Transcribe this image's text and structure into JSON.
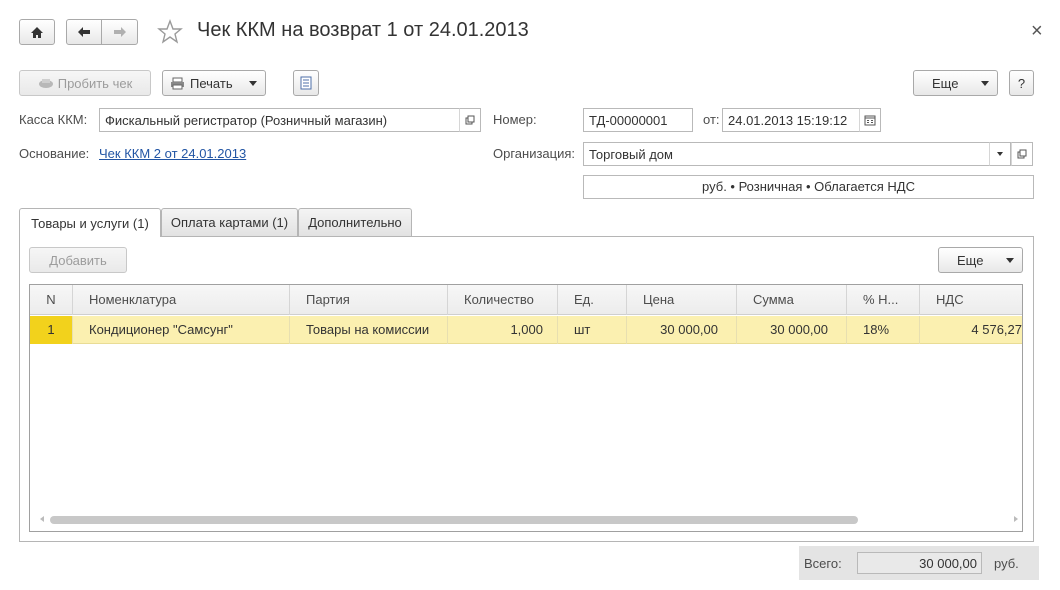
{
  "window": {
    "title": "Чек ККМ на возврат 1 от 24.01.2013",
    "close_glyph": "×"
  },
  "toolbar": {
    "punch_check": "Пробить чек",
    "print": "Печать",
    "more": "Еще",
    "help": "?"
  },
  "form": {
    "cash_register_label": "Касса ККМ:",
    "cash_register_value": "Фискальный регистратор (Розничный магазин)",
    "number_label": "Номер:",
    "number_value": "ТД-00000001",
    "date_label": "от:",
    "date_value": "24.01.2013 15:19:12",
    "basis_label": "Основание:",
    "basis_link": "Чек ККМ 2 от 24.01.2013",
    "organization_label": "Организация:",
    "organization_value": "Торговый дом",
    "price_info": "руб. • Розничная • Облагается НДС"
  },
  "tabs": [
    {
      "label": "Товары и услуги (1)",
      "active": true
    },
    {
      "label": "Оплата картами (1)",
      "active": false
    },
    {
      "label": "Дополнительно",
      "active": false
    }
  ],
  "table_toolbar": {
    "add": "Добавить",
    "more": "Еще"
  },
  "table": {
    "columns": [
      "N",
      "Номенклатура",
      "Партия",
      "Количество",
      "Ед.",
      "Цена",
      "Сумма",
      "% Н...",
      "НДС"
    ],
    "rows": [
      [
        "1",
        "Кондиционер \"Самсунг\"",
        "Товары на комиссии",
        "1,000",
        "шт",
        "30 000,00",
        "30 000,00",
        "18%",
        "4 576,27"
      ]
    ]
  },
  "footer": {
    "total_label": "Всего:",
    "total_value": "30 000,00",
    "currency": "руб."
  },
  "colors": {
    "selected_row": "#fbf0b0",
    "selected_cell": "#f2d21c",
    "link": "#2255a4"
  }
}
